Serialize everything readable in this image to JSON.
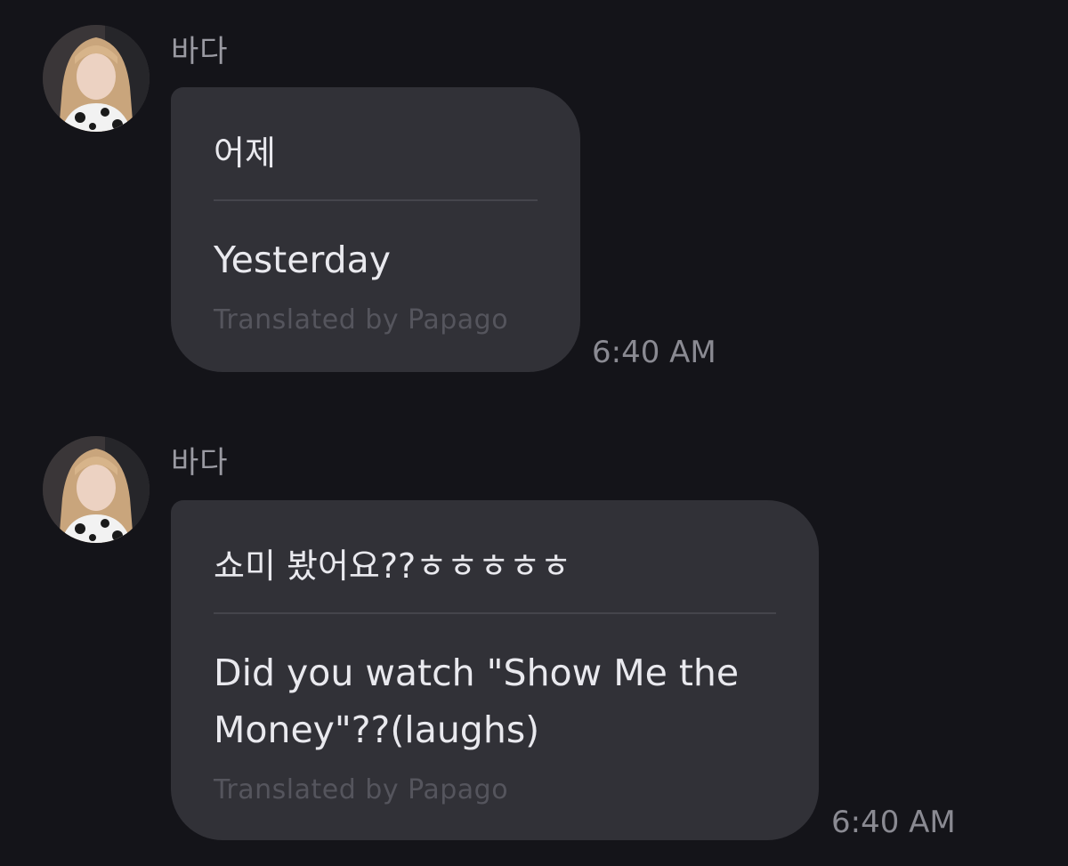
{
  "messages": [
    {
      "sender": "바다",
      "original": "어제",
      "translated": "Yesterday",
      "credit": "Translated by Papago",
      "time": "6:40 AM"
    },
    {
      "sender": "바다",
      "original": "쇼미 봤어요??ㅎㅎㅎㅎㅎ",
      "translated": "Did you watch \"Show Me the Money\"??(laughs)",
      "credit": "Translated by Papago",
      "time": "6:40 AM"
    }
  ]
}
